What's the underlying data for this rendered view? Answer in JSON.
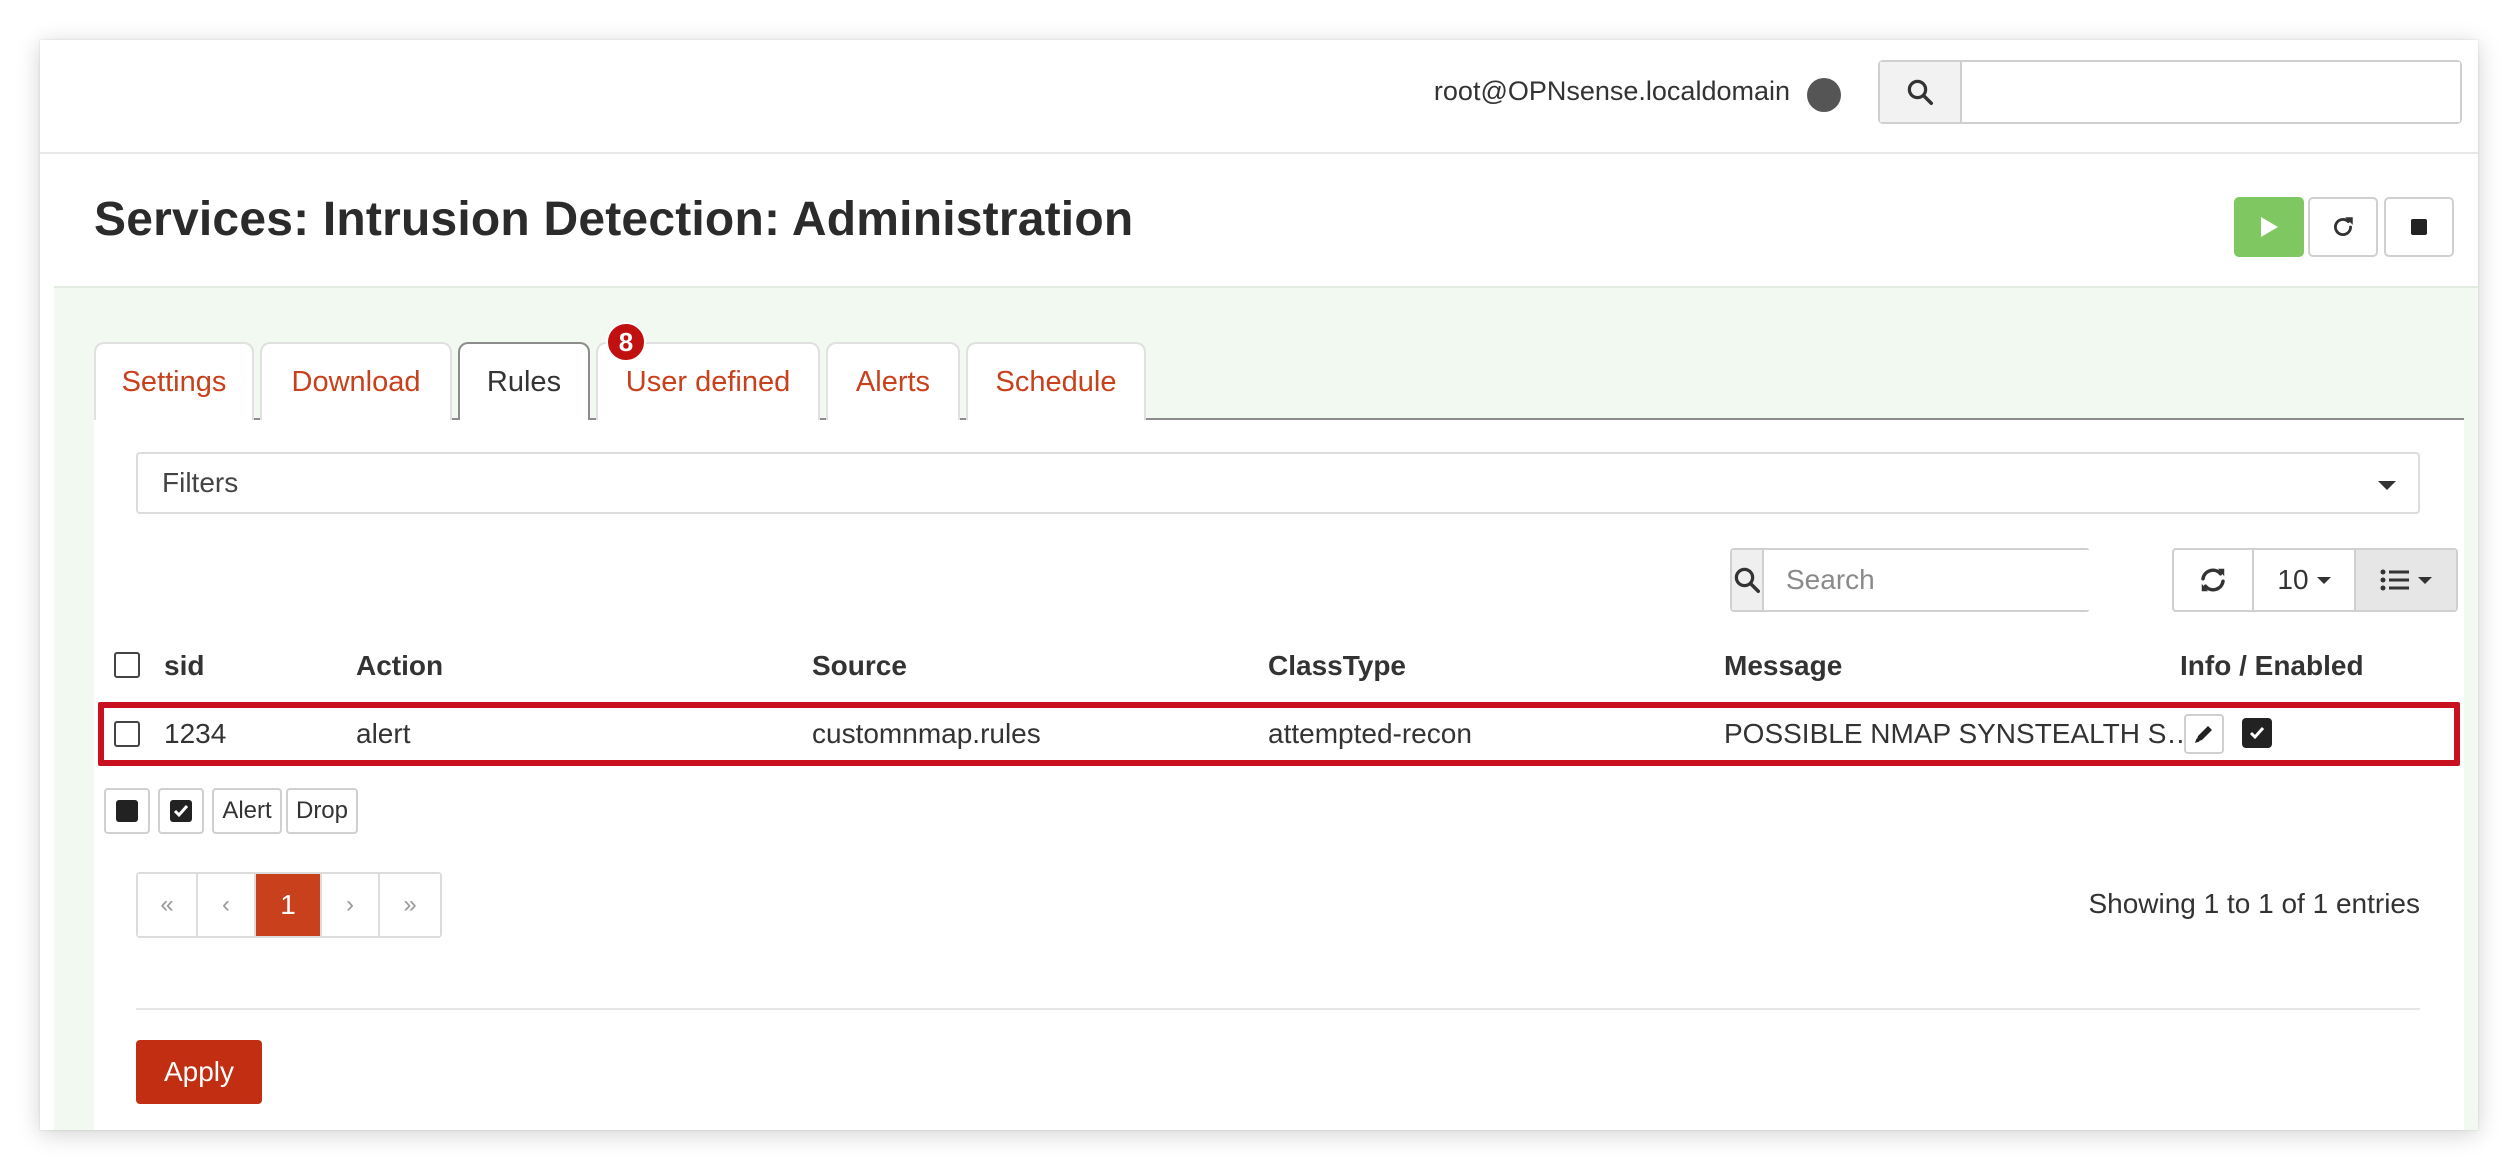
{
  "topbar": {
    "user": "root@OPNsense.localdomain",
    "search_placeholder": ""
  },
  "page": {
    "title": "Services: Intrusion Detection: Administration"
  },
  "tabs": [
    {
      "label": "Settings",
      "active": false
    },
    {
      "label": "Download",
      "active": false
    },
    {
      "label": "Rules",
      "active": true
    },
    {
      "label": "User defined",
      "active": false
    },
    {
      "label": "Alerts",
      "active": false
    },
    {
      "label": "Schedule",
      "active": false
    }
  ],
  "tab_badge": "8",
  "filters": {
    "label": "Filters"
  },
  "grid": {
    "search_placeholder": "Search",
    "page_size": "10"
  },
  "table": {
    "columns": [
      "sid",
      "Action",
      "Source",
      "ClassType",
      "Message",
      "Info / Enabled"
    ],
    "rows": [
      {
        "sid": "1234",
        "action": "alert",
        "source": "customnmap.rules",
        "classtype": "attempted-recon",
        "message": "POSSIBLE NMAP SYNSTEALTH S…",
        "enabled": true
      }
    ]
  },
  "bulk_actions": {
    "alert_label": "Alert",
    "drop_label": "Drop"
  },
  "pagination": {
    "first": "«",
    "prev": "‹",
    "current": "1",
    "next": "›",
    "last": "»"
  },
  "entries_text": "Showing 1 to 1 of 1 entries",
  "apply_label": "Apply",
  "colors": {
    "accent": "#c8401c",
    "play": "#7ec761",
    "highlight": "#c8101f",
    "badge": "#c01010"
  }
}
